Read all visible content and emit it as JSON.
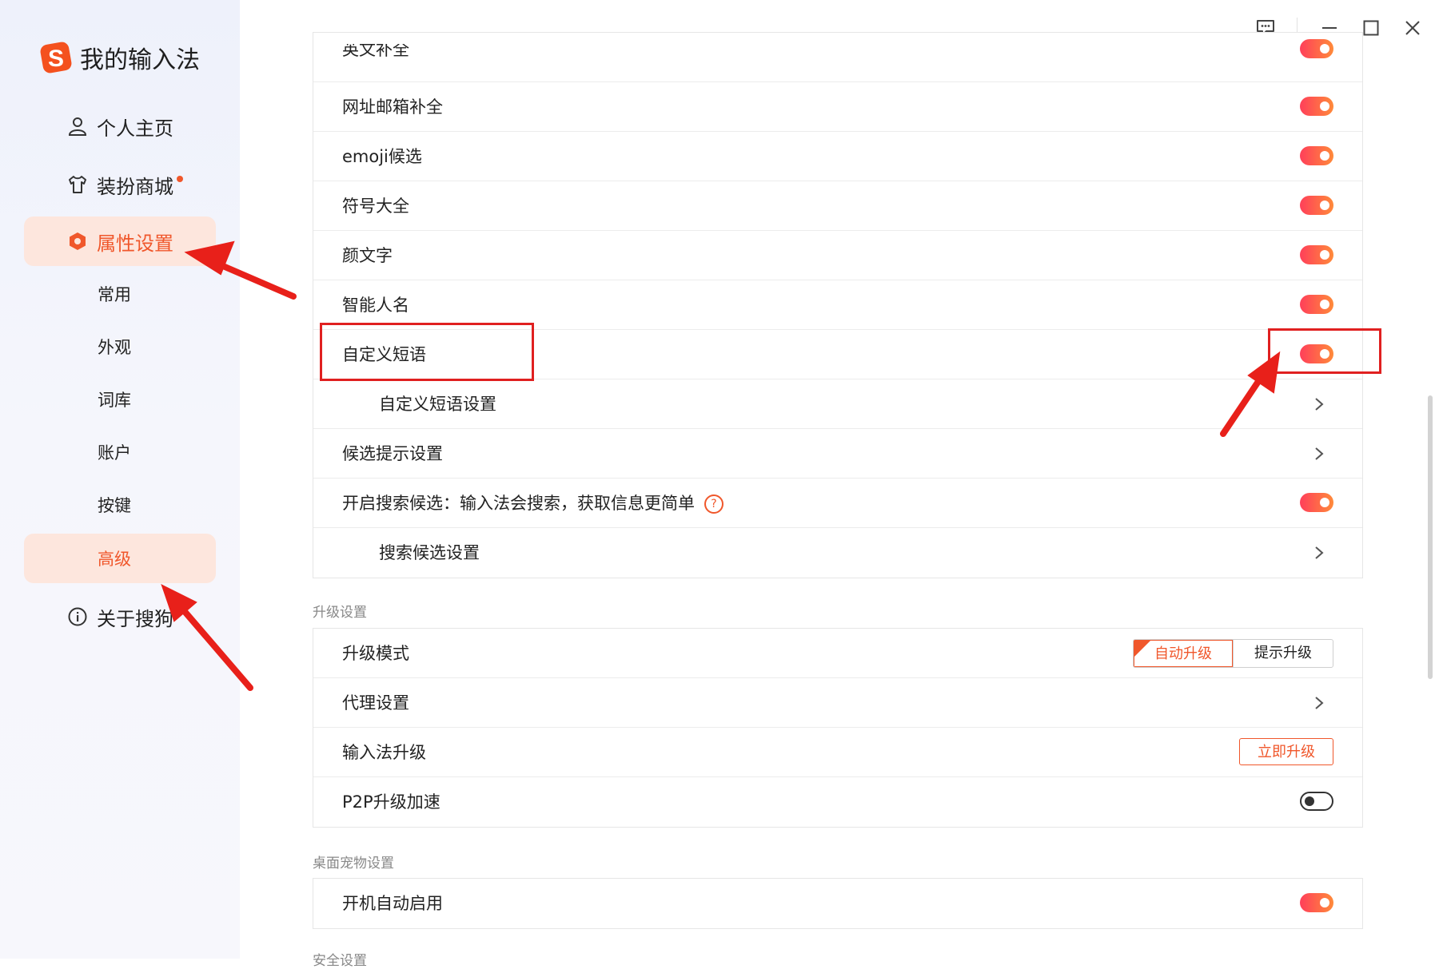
{
  "app": {
    "title": "我的输入法"
  },
  "sidebar": {
    "items": [
      {
        "label": "个人主页",
        "icon": "user-icon"
      },
      {
        "label": "装扮商城",
        "icon": "shirt-icon"
      },
      {
        "label": "属性设置",
        "icon": "settings-hex-icon"
      },
      {
        "label": "关于搜狗",
        "icon": "info-icon"
      }
    ],
    "sub_items": [
      "常用",
      "外观",
      "词库",
      "账户",
      "按键",
      "高级"
    ]
  },
  "colors": {
    "accent": "#f0572b",
    "toggle_start": "#ff3f5a",
    "toggle_end": "#ff8a3a",
    "highlight": "#e02020"
  },
  "rows": {
    "partial_top": "英文补全",
    "url_email": "网址邮箱补全",
    "emoji": "emoji候选",
    "symbols": "符号大全",
    "kaomoji": "颜文字",
    "smart_name": "智能人名",
    "custom_phrase": "自定义短语",
    "custom_phrase_settings": "自定义短语设置",
    "candidate_hint": "候选提示设置",
    "search_candidate": "开启搜索候选：输入法会搜索，获取信息更简单",
    "search_candidate_settings": "搜索候选设置"
  },
  "upgrade": {
    "section_title": "升级设置",
    "mode_label": "升级模式",
    "mode_options": [
      "自动升级",
      "提示升级"
    ],
    "proxy_label": "代理设置",
    "ime_upgrade_label": "输入法升级",
    "upgrade_now": "立即升级",
    "p2p_label": "P2P升级加速"
  },
  "pet": {
    "section_title": "桌面宠物设置",
    "autostart_label": "开机自动启用"
  },
  "security": {
    "section_title": "安全设置"
  },
  "help_glyph": "?"
}
